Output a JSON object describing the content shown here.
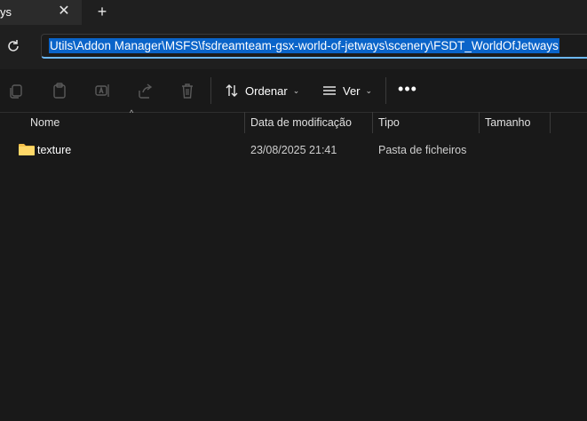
{
  "tab": {
    "title": "ys",
    "close_glyph": "✕",
    "new_glyph": "+"
  },
  "address": {
    "path": "Utils\\Addon Manager\\MSFS\\fsdreamteam-gsx-world-of-jetways\\scenery\\FSDT_WorldOfJetways"
  },
  "toolbar": {
    "sort_label": "Ordenar",
    "view_label": "Ver",
    "more_label": "•••",
    "icons": [
      "copy-icon",
      "paste-icon",
      "rename-icon",
      "share-icon",
      "delete-icon",
      "sort-icon",
      "view-icon"
    ]
  },
  "columns": [
    {
      "label": "Nome"
    },
    {
      "label": "Data de modificação"
    },
    {
      "label": "Tipo"
    },
    {
      "label": "Tamanho"
    }
  ],
  "rows": [
    {
      "name": "texture",
      "date": "23/08/2025 21:41",
      "type": "Pasta de ficheiros",
      "size": ""
    }
  ],
  "colors": {
    "accent": "#0a64c9",
    "focus_underline": "#6cb8f6",
    "folder": "#f5c04a",
    "background": "#191919"
  }
}
